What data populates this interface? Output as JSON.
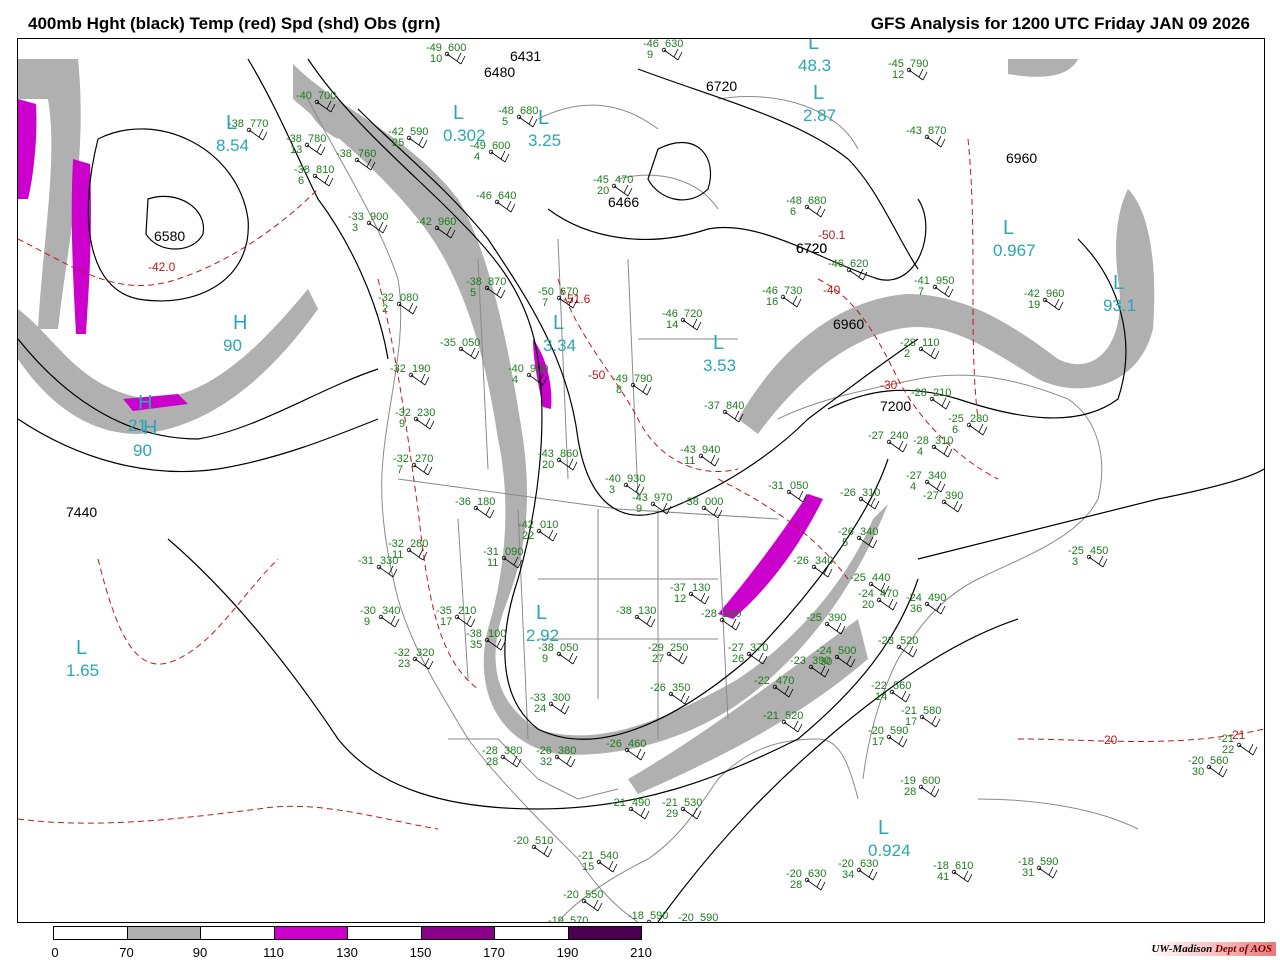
{
  "header": {
    "left_title": "400mb Hght (black) Temp (red) Spd (shd) Obs (grn)",
    "right_title": "GFS Analysis for 1200 UTC Friday  JAN 09 2026"
  },
  "legend": {
    "ticks": [
      "0",
      "70",
      "90",
      "110",
      "130",
      "150",
      "170",
      "190",
      "210"
    ],
    "fills": [
      "#ffffff",
      "#b0b0b0",
      "#ffffff",
      "#cc00cc",
      "#ffffff",
      "#8b008b",
      "#ffffff",
      "#4b0050"
    ]
  },
  "credit": {
    "org": "UW-Madison",
    "dept": "Dept of AOS"
  },
  "colors": {
    "height": "#000000",
    "temperature": "#c01818",
    "speed_70": "#b0b0b0",
    "speed_110": "#cc00cc",
    "obs": "#1e7d1e",
    "lows": "#2aa7b5",
    "boundaries": "#8a8a8a"
  },
  "height_labels": [
    "6431",
    "6480",
    "6720",
    "6960",
    "6580",
    "6720",
    "6466",
    "6720",
    "6960",
    "7200",
    "7440"
  ],
  "temperature_labels": [
    "-42.0",
    "-50.1",
    "-51.6",
    "-50",
    "-40",
    "-30",
    "-20",
    "-21"
  ],
  "pressure_lows": [
    {
      "letter": "L",
      "value": "48.3"
    },
    {
      "letter": "L",
      "value": "2.87"
    },
    {
      "letter": "L",
      "value": "0.302"
    },
    {
      "letter": "L",
      "value": "3.25"
    },
    {
      "letter": "L",
      "value": "8.54"
    },
    {
      "letter": "L",
      "value": "3.34"
    },
    {
      "letter": "L",
      "value": "3.53"
    },
    {
      "letter": "L",
      "value": "0.967"
    },
    {
      "letter": "L",
      "value": "93.1"
    },
    {
      "letter": "L",
      "value": "2.92"
    },
    {
      "letter": "L",
      "value": "1.65"
    },
    {
      "letter": "L",
      "value": "0.924"
    },
    {
      "letter": "H",
      "value": "90"
    },
    {
      "letter": "H",
      "value": "21"
    },
    {
      "letter": "H",
      "value": "90"
    }
  ],
  "observations": [
    {
      "t": "-49",
      "h": "600",
      "d": "10"
    },
    {
      "t": "-46",
      "h": "630",
      "d": "9"
    },
    {
      "t": "-45",
      "h": "790",
      "d": "12"
    },
    {
      "t": "-40",
      "h": "700",
      "d": ""
    },
    {
      "t": "-38",
      "h": "770",
      "d": ""
    },
    {
      "t": "-38",
      "h": "780",
      "d": "13"
    },
    {
      "t": "-38",
      "h": "760",
      "d": ""
    },
    {
      "t": "-38",
      "h": "810",
      "d": "6"
    },
    {
      "t": "-42",
      "h": "590",
      "d": "25"
    },
    {
      "t": "-49",
      "h": "600",
      "d": "4"
    },
    {
      "t": "-48",
      "h": "680",
      "d": "5"
    },
    {
      "t": "-43",
      "h": "870",
      "d": ""
    },
    {
      "t": "-46",
      "h": "640",
      "d": ""
    },
    {
      "t": "-48",
      "h": "680",
      "d": "6"
    },
    {
      "t": "-45",
      "h": "470",
      "d": "20"
    },
    {
      "t": "-33",
      "h": "900",
      "d": "3"
    },
    {
      "t": "-42",
      "h": "960",
      "d": ""
    },
    {
      "t": "-46",
      "h": "620",
      "d": ""
    },
    {
      "t": "-41",
      "h": "950",
      "d": "7"
    },
    {
      "t": "-32",
      "h": "080",
      "d": "2"
    },
    {
      "t": "-38",
      "h": "870",
      "d": "5"
    },
    {
      "t": "-50",
      "h": "670",
      "d": "7"
    },
    {
      "t": "-46",
      "h": "730",
      "d": "16"
    },
    {
      "t": "-46",
      "h": "720",
      "d": "14"
    },
    {
      "t": "-42",
      "h": "960",
      "d": "19"
    },
    {
      "t": "-35",
      "h": "050",
      "d": ""
    },
    {
      "t": "-32",
      "h": "190",
      "d": ""
    },
    {
      "t": "-40",
      "h": "900",
      "d": "4"
    },
    {
      "t": "-49",
      "h": "790",
      "d": "8"
    },
    {
      "t": "-37",
      "h": "840",
      "d": ""
    },
    {
      "t": "-28",
      "h": "110",
      "d": "2"
    },
    {
      "t": "-28",
      "h": "210",
      "d": ""
    },
    {
      "t": "-25",
      "h": "280",
      "d": "6"
    },
    {
      "t": "-32",
      "h": "230",
      "d": "9"
    },
    {
      "t": "-27",
      "h": "240",
      "d": ""
    },
    {
      "t": "-28",
      "h": "310",
      "d": "4"
    },
    {
      "t": "-32",
      "h": "270",
      "d": "7"
    },
    {
      "t": "-43",
      "h": "860",
      "d": "20"
    },
    {
      "t": "-43",
      "h": "940",
      "d": "11"
    },
    {
      "t": "-27",
      "h": "340",
      "d": "4"
    },
    {
      "t": "-40",
      "h": "930",
      "d": "3"
    },
    {
      "t": "-27",
      "h": "390",
      "d": ""
    },
    {
      "t": "-36",
      "h": "180",
      "d": ""
    },
    {
      "t": "-43",
      "h": "970",
      "d": "9"
    },
    {
      "t": "-38",
      "h": "000",
      "d": ""
    },
    {
      "t": "-31",
      "h": "050",
      "d": ""
    },
    {
      "t": "-26",
      "h": "310",
      "d": ""
    },
    {
      "t": "-42",
      "h": "010",
      "d": "22"
    },
    {
      "t": "-32",
      "h": "280",
      "d": "11"
    },
    {
      "t": "-31",
      "h": "090",
      "d": "11"
    },
    {
      "t": "-26",
      "h": "340",
      "d": "5"
    },
    {
      "t": "-31",
      "h": "330",
      "d": ""
    },
    {
      "t": "-26",
      "h": "340",
      "d": ""
    },
    {
      "t": "-25",
      "h": "450",
      "d": "3"
    },
    {
      "t": "-37",
      "h": "130",
      "d": "12"
    },
    {
      "t": "-25",
      "h": "440",
      "d": ""
    },
    {
      "t": "-30",
      "h": "340",
      "d": "9"
    },
    {
      "t": "-35",
      "h": "210",
      "d": "17"
    },
    {
      "t": "-38",
      "h": "130",
      "d": ""
    },
    {
      "t": "-28",
      "h": "240",
      "d": ""
    },
    {
      "t": "-24",
      "h": "470",
      "d": "20"
    },
    {
      "t": "-24",
      "h": "490",
      "d": "36"
    },
    {
      "t": "-25",
      "h": "390",
      "d": ""
    },
    {
      "t": "-38",
      "h": "100",
      "d": "35"
    },
    {
      "t": "-23",
      "h": "520",
      "d": ""
    },
    {
      "t": "-32",
      "h": "320",
      "d": "23"
    },
    {
      "t": "-38",
      "h": "050",
      "d": "9"
    },
    {
      "t": "-29",
      "h": "250",
      "d": "27"
    },
    {
      "t": "-27",
      "h": "370",
      "d": "26"
    },
    {
      "t": "-24",
      "h": "500",
      "d": "30"
    },
    {
      "t": "-23",
      "h": "390",
      "d": ""
    },
    {
      "t": "-22",
      "h": "560",
      "d": "14"
    },
    {
      "t": "-33",
      "h": "300",
      "d": "24"
    },
    {
      "t": "-26",
      "h": "350",
      "d": ""
    },
    {
      "t": "-22",
      "h": "470",
      "d": ""
    },
    {
      "t": "-21",
      "h": "580",
      "d": "17"
    },
    {
      "t": "-21",
      "h": "520",
      "d": ""
    },
    {
      "t": "-20",
      "h": "590",
      "d": "17"
    },
    {
      "t": "-28",
      "h": "380",
      "d": "28"
    },
    {
      "t": "-26",
      "h": "380",
      "d": "32"
    },
    {
      "t": "-26",
      "h": "460",
      "d": ""
    },
    {
      "t": "-20",
      "h": "560",
      "d": "30"
    },
    {
      "t": "-21",
      "h": "",
      "d": "22"
    },
    {
      "t": "-19",
      "h": "600",
      "d": "28"
    },
    {
      "t": "-21",
      "h": "490",
      "d": ""
    },
    {
      "t": "-21",
      "h": "530",
      "d": "29"
    },
    {
      "t": "-20",
      "h": "510",
      "d": ""
    },
    {
      "t": "-21",
      "h": "540",
      "d": "15"
    },
    {
      "t": "-20",
      "h": "630",
      "d": "28"
    },
    {
      "t": "-20",
      "h": "630",
      "d": "34"
    },
    {
      "t": "-18",
      "h": "610",
      "d": "41"
    },
    {
      "t": "-18",
      "h": "590",
      "d": "31"
    },
    {
      "t": "-20",
      "h": "550",
      "d": ""
    },
    {
      "t": "-19",
      "h": "570",
      "d": ""
    },
    {
      "t": "-18",
      "h": "590",
      "d": ""
    },
    {
      "t": "-20",
      "h": "590",
      "d": ""
    }
  ]
}
